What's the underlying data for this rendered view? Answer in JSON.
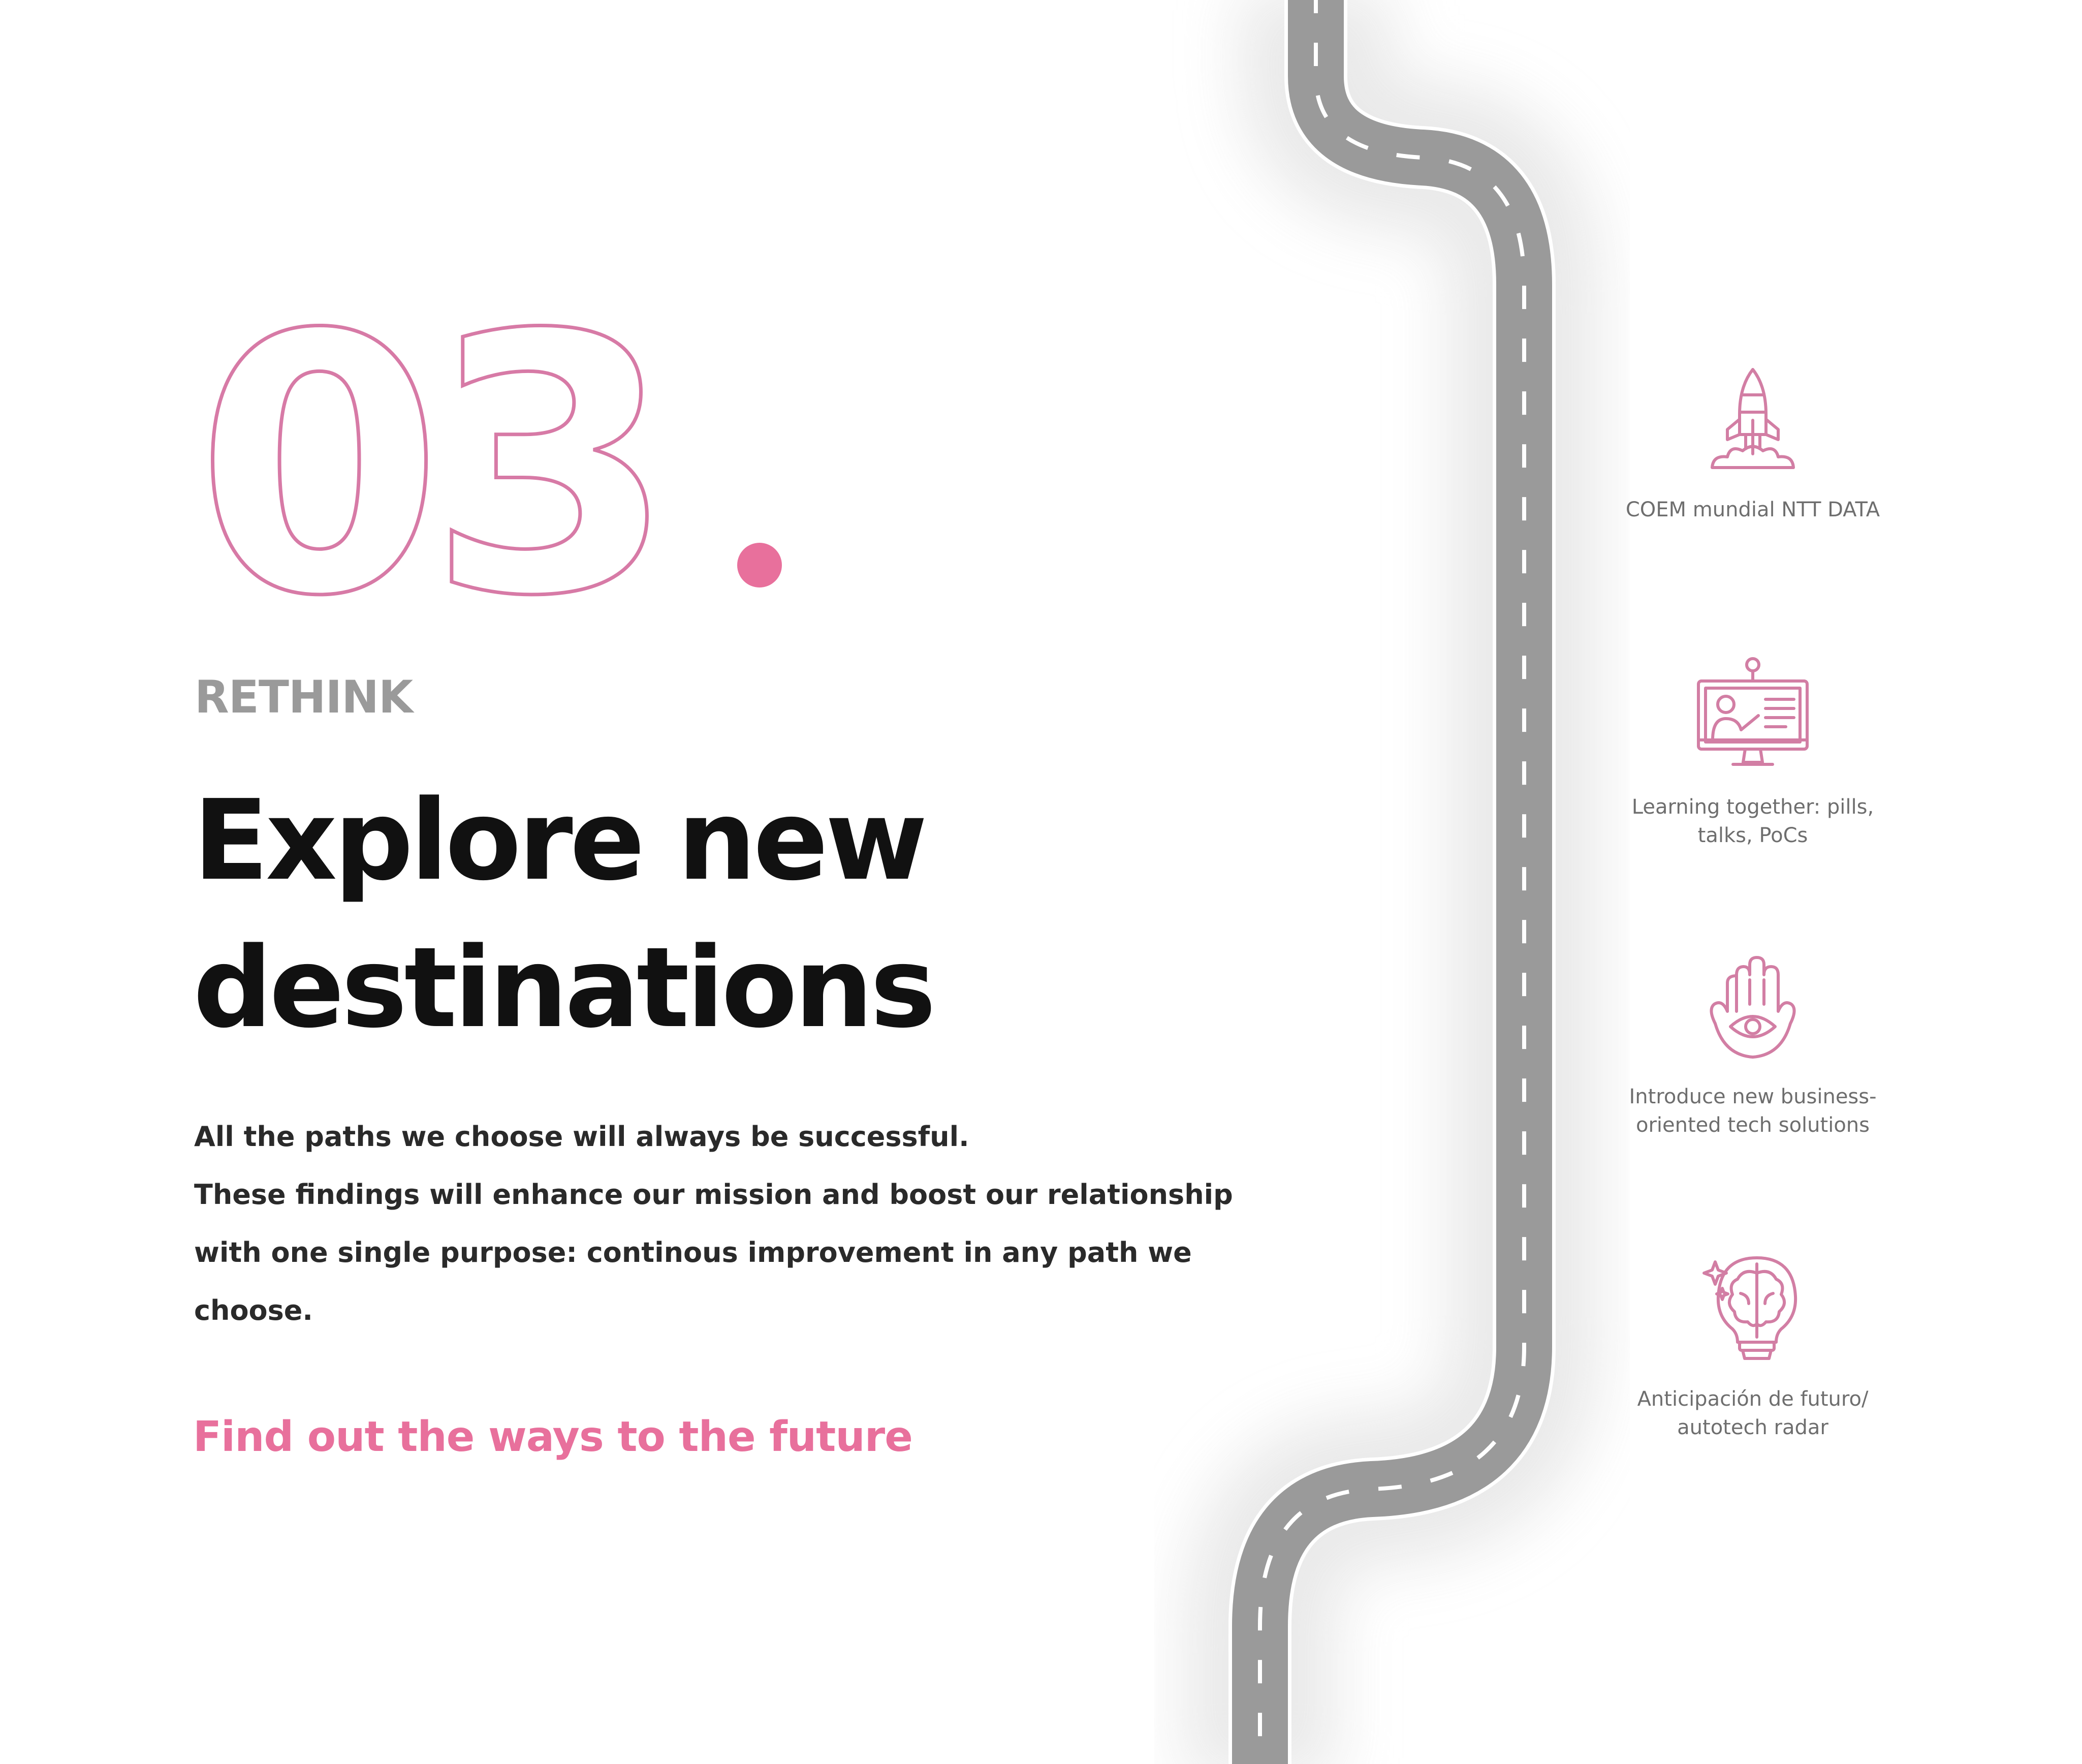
{
  "section": {
    "number": "03",
    "number_dot": ".",
    "kicker": "RETHINK",
    "headline": [
      "Explore new",
      "destinations"
    ],
    "body": [
      "All the paths we choose will always be successful.",
      "These findings will enhance our mission and boost our relationship",
      "with one single purpose: continous improvement in any path we",
      "choose."
    ],
    "cta": "Find out the ways to the future"
  },
  "features": [
    {
      "icon": "rocket-icon",
      "lines": [
        "COEM mundial NTT DATA"
      ]
    },
    {
      "icon": "presentation-monitor-icon",
      "lines": [
        "Learning together: pills,",
        "talks, PoCs"
      ]
    },
    {
      "icon": "hamsa-hand-eye-icon",
      "lines": [
        "Introduce new business-",
        "oriented tech solutions"
      ]
    },
    {
      "icon": "brain-lightbulb-icon",
      "lines": [
        "Anticipación de futuro/",
        "autotech radar"
      ]
    }
  ],
  "colors": {
    "accent": "#e8709c",
    "icon_stroke": "#d27ea4",
    "road": "#9a9a9a",
    "kicker": "#9a9a9a",
    "headline": "#111111"
  }
}
